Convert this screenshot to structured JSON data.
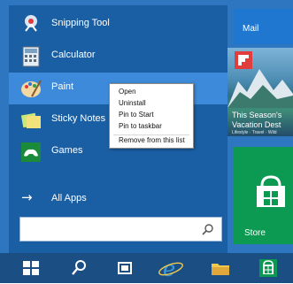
{
  "start_menu": {
    "apps": [
      {
        "label": "Snipping Tool",
        "icon": "snipping-tool-icon"
      },
      {
        "label": "Calculator",
        "icon": "calculator-icon"
      },
      {
        "label": "Paint",
        "icon": "paint-icon",
        "selected": true
      },
      {
        "label": "Sticky Notes",
        "icon": "sticky-notes-icon"
      },
      {
        "label": "Games",
        "icon": "games-icon"
      }
    ],
    "all_apps_label": "All Apps",
    "search": {
      "value": "",
      "icon": "search-icon"
    }
  },
  "tiles": {
    "mail": {
      "label": "Mail"
    },
    "news": {
      "headline": "This Season's\nVacation Dest",
      "sub": "Lifestyle · Travel · Wild"
    },
    "store": {
      "label": "Store"
    }
  },
  "context_menu": {
    "items": [
      "Open",
      "Uninstall",
      "Pin to Start",
      "Pin to taskbar",
      "Remove from this list"
    ]
  },
  "taskbar": {
    "items": [
      "windows-logo-icon",
      "search-icon",
      "task-view-icon",
      "internet-explorer-icon",
      "file-explorer-icon",
      "store-icon"
    ]
  },
  "colors": {
    "start_bg": "#2f76c1",
    "left_pane": "#1a5fa4",
    "selected": "#3c8ad9",
    "taskbar": "#1b4f84",
    "mail_tile": "#1f77d0",
    "store_tile": "#0c9a52"
  }
}
